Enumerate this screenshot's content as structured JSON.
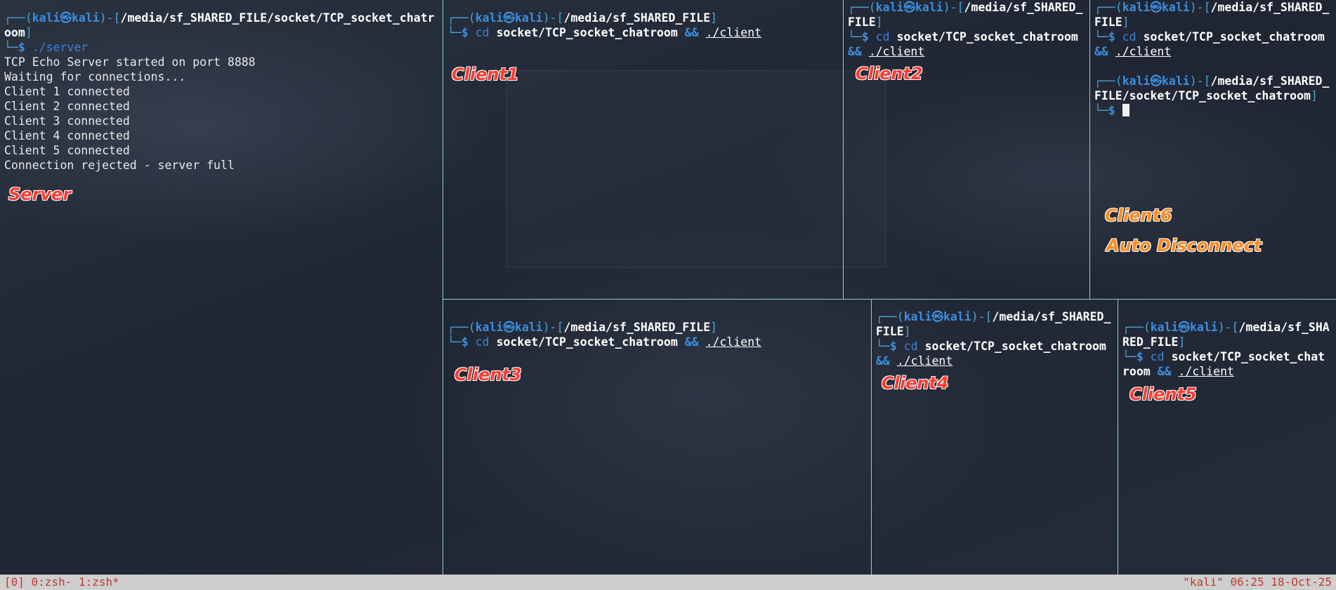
{
  "prompt": {
    "box_top": "┌──",
    "box_bottom": "└─",
    "open_paren": "(",
    "user": "kali㉿kali",
    "close_paren_bracket": ")-[",
    "close_bracket": "]",
    "dollar": "$"
  },
  "server": {
    "path": "/media/sf_SHARED_FILE/socket/TCP_socket_chatroom",
    "command": "./server",
    "output": [
      "TCP Echo Server started on port 8888",
      "Waiting for connections...",
      "Client 1 connected",
      "Client 2 connected",
      "Client 3 connected",
      "Client 4 connected",
      "Client 5 connected",
      "Connection rejected - server full"
    ],
    "label": "Server"
  },
  "client1": {
    "path": "/media/sf_SHARED_FILE",
    "cmd": "cd",
    "arg": "socket/TCP_socket_chatroom",
    "amp": "&&",
    "prog": "./client",
    "label": "Client1"
  },
  "client2": {
    "path": "/media/sf_SHARED_FILE",
    "cmd": "cd",
    "arg": "socket/TCP_socket_chatroom",
    "amp": "&&",
    "prog": "./client",
    "label": "Client2"
  },
  "client6": {
    "path": "/media/sf_SHARED_FILE",
    "cmd": "cd",
    "arg": "socket/TCP_socket_chatroom",
    "amp": "&&",
    "prog": "./client",
    "path2": "/media/sf_SHARED_FILE/socket/TCP_socket_chatroom",
    "label": "Client6",
    "label2": "Auto Disconnect"
  },
  "client3": {
    "path": "/media/sf_SHARED_FILE",
    "cmd": "cd",
    "arg": "socket/TCP_socket_chatroom",
    "amp": "&&",
    "prog": "./client",
    "label": "Client3"
  },
  "client4": {
    "path": "/media/sf_SHARED_FILE",
    "cmd": "cd",
    "arg": "socket/TCP_socket_chatroom",
    "amp": "&&",
    "prog": "./client",
    "label": "Client4"
  },
  "client5": {
    "path": "/media/sf_SHARED_FILE",
    "cmd": "cd",
    "arg": "socket/TCP_socket_chatroom",
    "amp": "&&",
    "prog": "./client",
    "label": "Client5"
  },
  "statusbar": {
    "left": "[0] 0:zsh- 1:zsh*",
    "right": "\"kali\" 06:25 18-Oct-25"
  }
}
